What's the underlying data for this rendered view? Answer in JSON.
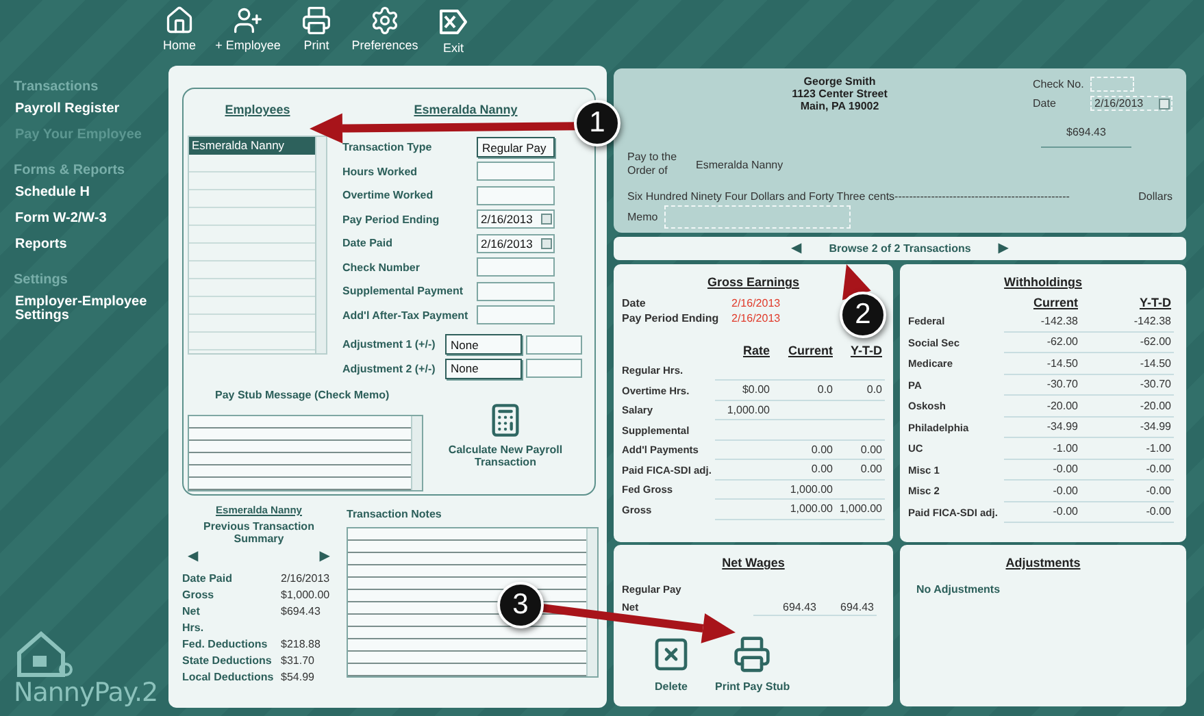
{
  "toolbar": [
    {
      "label": "Home"
    },
    {
      "label": "+ Employee"
    },
    {
      "label": "Print"
    },
    {
      "label": "Preferences"
    },
    {
      "label": "Exit"
    }
  ],
  "sidebar": {
    "sections": [
      {
        "title": "Transactions",
        "items": [
          {
            "label": "Payroll Register",
            "disabled": false
          },
          {
            "label": "Pay Your Employee",
            "disabled": true
          }
        ]
      },
      {
        "title": "Forms & Reports",
        "items": [
          {
            "label": "Schedule H",
            "disabled": false
          },
          {
            "label": "Form W-2/W-3",
            "disabled": false
          },
          {
            "label": "Reports",
            "disabled": false
          }
        ]
      },
      {
        "title": "Settings",
        "items": [
          {
            "label": "Employer-Employee Settings",
            "disabled": false
          }
        ]
      }
    ]
  },
  "logo": {
    "text": "NannyPay.2"
  },
  "employees": {
    "title": "Employees",
    "items": [
      {
        "name": "Esmeralda Nanny",
        "selected": true
      }
    ]
  },
  "form": {
    "title": "Esmeralda Nanny",
    "fields": [
      {
        "label": "Transaction Type",
        "kind": "select",
        "value": "Regular Pay"
      },
      {
        "label": "Hours Worked",
        "kind": "text"
      },
      {
        "label": "Overtime Worked",
        "kind": "text"
      },
      {
        "label": "Pay Period Ending",
        "kind": "date",
        "value": "2/16/2013"
      },
      {
        "label": "Date Paid",
        "kind": "date",
        "value": "2/16/2013"
      },
      {
        "label": "Check Number",
        "kind": "text"
      },
      {
        "label": "Supplemental Payment",
        "kind": "text"
      },
      {
        "label": "Add'l After-Tax Payment",
        "kind": "text"
      },
      {
        "label": "Adjustment 1 (+/-)",
        "kind": "adjust",
        "value": "None"
      },
      {
        "label": "Adjustment 2 (+/-)",
        "kind": "adjust",
        "value": "None"
      }
    ]
  },
  "memo": {
    "title": "Pay Stub Message (Check Memo)"
  },
  "calculate": {
    "label": "Calculate New Payroll Transaction"
  },
  "summary": {
    "employee": "Esmeralda Nanny",
    "title": "Previous Transaction Summary",
    "prev": "◀",
    "next": "▶",
    "rows": [
      {
        "label": "Date Paid",
        "value": "2/16/2013"
      },
      {
        "label": "Gross",
        "value": "$1,000.00"
      },
      {
        "label": "Net",
        "value": "$694.43"
      },
      {
        "label": "Hrs."
      },
      {
        "label": "Fed. Deductions",
        "value": "$218.88"
      },
      {
        "label": "State Deductions",
        "value": "$31.70"
      },
      {
        "label": "Local Deductions",
        "value": "$54.99"
      }
    ]
  },
  "notes": {
    "title": "Transaction Notes"
  },
  "check": {
    "payer": [
      "George  Smith",
      "1123 Center Street",
      "Main, PA 19002"
    ],
    "check_no_label": "Check No.",
    "date_label": "Date",
    "date": "2/16/2013",
    "amount": "$694.43",
    "pay_to_label": [
      "Pay to the",
      "Order of"
    ],
    "payee": "Esmeralda Nanny",
    "amount_words": "Six Hundred Ninety Four Dollars and Forty Three cents------------------------------------------------",
    "dollars_label": "Dollars",
    "memo_label": "Memo"
  },
  "browse": {
    "prev": "◀",
    "label": "Browse 2 of 2 Transactions",
    "next": "▶"
  },
  "gross": {
    "title": "Gross Earnings",
    "dates": [
      {
        "label": "Date",
        "value": "2/16/2013"
      },
      {
        "label": "Pay Period Ending",
        "value": "2/16/2013"
      }
    ],
    "columns": [
      "Rate",
      "Current",
      "Y-T-D"
    ],
    "rows": [
      {
        "label": "Regular Hrs."
      },
      {
        "label": "Overtime Hrs.",
        "rate": "$0.00",
        "current": "0.0",
        "ytd": "0.0"
      },
      {
        "label": "Salary",
        "rate": "1,000.00"
      },
      {
        "label": "Supplemental"
      },
      {
        "label": "Add'l Payments",
        "current": "0.00",
        "ytd": "0.00"
      },
      {
        "label": "Paid FICA-SDI adj.",
        "current": "0.00",
        "ytd": "0.00"
      },
      {
        "label": "Fed Gross",
        "current": "1,000.00"
      },
      {
        "label": "Gross",
        "current": "1,000.00",
        "ytd": "1,000.00"
      }
    ]
  },
  "withholdings": {
    "title": "Withholdings",
    "columns": [
      "Current",
      "Y-T-D"
    ],
    "rows": [
      {
        "label": "Federal",
        "values": [
          "-142.38",
          "-142.38"
        ]
      },
      {
        "label": "Social Sec",
        "values": [
          "-62.00",
          "-62.00"
        ]
      },
      {
        "label": "Medicare",
        "values": [
          "-14.50",
          "-14.50"
        ]
      },
      {
        "label": "PA",
        "values": [
          "-30.70",
          "-30.70"
        ]
      },
      {
        "label": "Oskosh",
        "values": [
          "-20.00",
          "-20.00"
        ]
      },
      {
        "label": "Philadelphia",
        "values": [
          "-34.99",
          "-34.99"
        ]
      },
      {
        "label": "UC",
        "values": [
          "-1.00",
          "-1.00"
        ]
      },
      {
        "label": "Misc 1",
        "values": [
          "-0.00",
          "-0.00"
        ]
      },
      {
        "label": "Misc 2",
        "values": [
          "-0.00",
          "-0.00"
        ]
      },
      {
        "label": "Paid FICA-SDI adj.",
        "values": [
          "-0.00",
          "-0.00"
        ]
      }
    ]
  },
  "net": {
    "title": "Net Wages",
    "rows": [
      {
        "label": "Regular Pay"
      },
      {
        "label": "Net",
        "current": "694.43",
        "ytd": "694.43"
      }
    ],
    "actions": [
      {
        "label": "Delete"
      },
      {
        "label": "Print Pay Stub"
      }
    ]
  },
  "adjustments": {
    "title": "Adjustments",
    "note": "No Adjustments"
  },
  "annotations": [
    {
      "number": "1"
    },
    {
      "number": "2"
    },
    {
      "number": "3"
    }
  ]
}
